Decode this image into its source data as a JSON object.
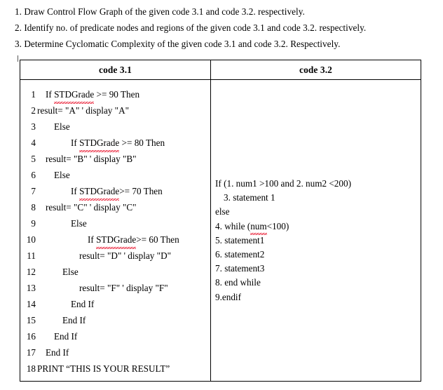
{
  "instructions": [
    "1. Draw Control Flow Graph of the given code 3.1 and code 3.2. respectively.",
    "2. Identify no. of predicate nodes and regions of the given code 3.1 and code 3.2. respectively.",
    "3. Determine Cyclomatic Complexity of the given code 3.1 and code 3.2. Respectively."
  ],
  "table": {
    "headers": {
      "left": "code 3.1",
      "right": "code 3.2"
    },
    "code_3_1": [
      {
        "num": "1",
        "indent": 1,
        "pre": "If ",
        "sq": "STDGrade",
        "post": " >= 90 Then"
      },
      {
        "num": "2",
        "indent": 0,
        "pre": "result= \"A\" ' display \"A\"",
        "sq": "",
        "post": ""
      },
      {
        "num": "3",
        "indent": 2,
        "pre": "Else",
        "sq": "",
        "post": ""
      },
      {
        "num": "4",
        "indent": 4,
        "pre": "If ",
        "sq": "STDGrade",
        "post": " >= 80 Then"
      },
      {
        "num": "5",
        "indent": 1,
        "pre": "result= \"B\" ' display \"B\"",
        "sq": "",
        "post": ""
      },
      {
        "num": "6",
        "indent": 2,
        "pre": "Else",
        "sq": "",
        "post": ""
      },
      {
        "num": "7",
        "indent": 4,
        "pre": "If ",
        "sq": "STDGrade",
        "post": ">= 70 Then"
      },
      {
        "num": "8",
        "indent": 1,
        "pre": "result= \"C\" ' display \"C\"",
        "sq": "",
        "post": ""
      },
      {
        "num": "9",
        "indent": 4,
        "pre": "Else",
        "sq": "",
        "post": ""
      },
      {
        "num": "10",
        "indent": 6,
        "pre": "If ",
        "sq": "STDGrade",
        "post": ">= 60 Then"
      },
      {
        "num": "11",
        "indent": 5,
        "pre": "result= \"D\" ' display \"D\"",
        "sq": "",
        "post": ""
      },
      {
        "num": "12",
        "indent": 3,
        "pre": "Else",
        "sq": "",
        "post": ""
      },
      {
        "num": "13",
        "indent": 5,
        "pre": "result= \"F\" ' display \"F\"",
        "sq": "",
        "post": ""
      },
      {
        "num": "14",
        "indent": 4,
        "pre": "End If",
        "sq": "",
        "post": ""
      },
      {
        "num": "15",
        "indent": 3,
        "pre": "End If",
        "sq": "",
        "post": ""
      },
      {
        "num": "16",
        "indent": 2,
        "pre": "End If",
        "sq": "",
        "post": ""
      },
      {
        "num": "17",
        "indent": 1,
        "pre": "End If",
        "sq": "",
        "post": ""
      },
      {
        "num": "18",
        "indent": 0,
        "pre": "PRINT “THIS IS YOUR RESULT”",
        "sq": "",
        "post": ""
      }
    ],
    "code_3_2": [
      {
        "indent": 0,
        "pre": "If (1. num1 >100 and 2. num2 <200)",
        "sq": "",
        "post": ""
      },
      {
        "indent": 1,
        "pre": "3. statement 1",
        "sq": "",
        "post": ""
      },
      {
        "indent": 0,
        "pre": "else",
        "sq": "",
        "post": ""
      },
      {
        "indent": 0,
        "pre": "4. while (",
        "sq": "num",
        "post": "<100)"
      },
      {
        "indent": 0,
        "pre": "5. statement1",
        "sq": "",
        "post": ""
      },
      {
        "indent": 0,
        "pre": "6. statement2",
        "sq": "",
        "post": ""
      },
      {
        "indent": 0,
        "pre": "7. statement3",
        "sq": "",
        "post": ""
      },
      {
        "indent": 0,
        "pre": "8. end while",
        "sq": "",
        "post": ""
      },
      {
        "indent": 0,
        "pre": "9.endif",
        "sq": "",
        "post": ""
      }
    ]
  },
  "colors": {
    "text": "#000000",
    "border": "#000000",
    "spellcheck_underline": "#e8001c",
    "background": "#ffffff"
  }
}
